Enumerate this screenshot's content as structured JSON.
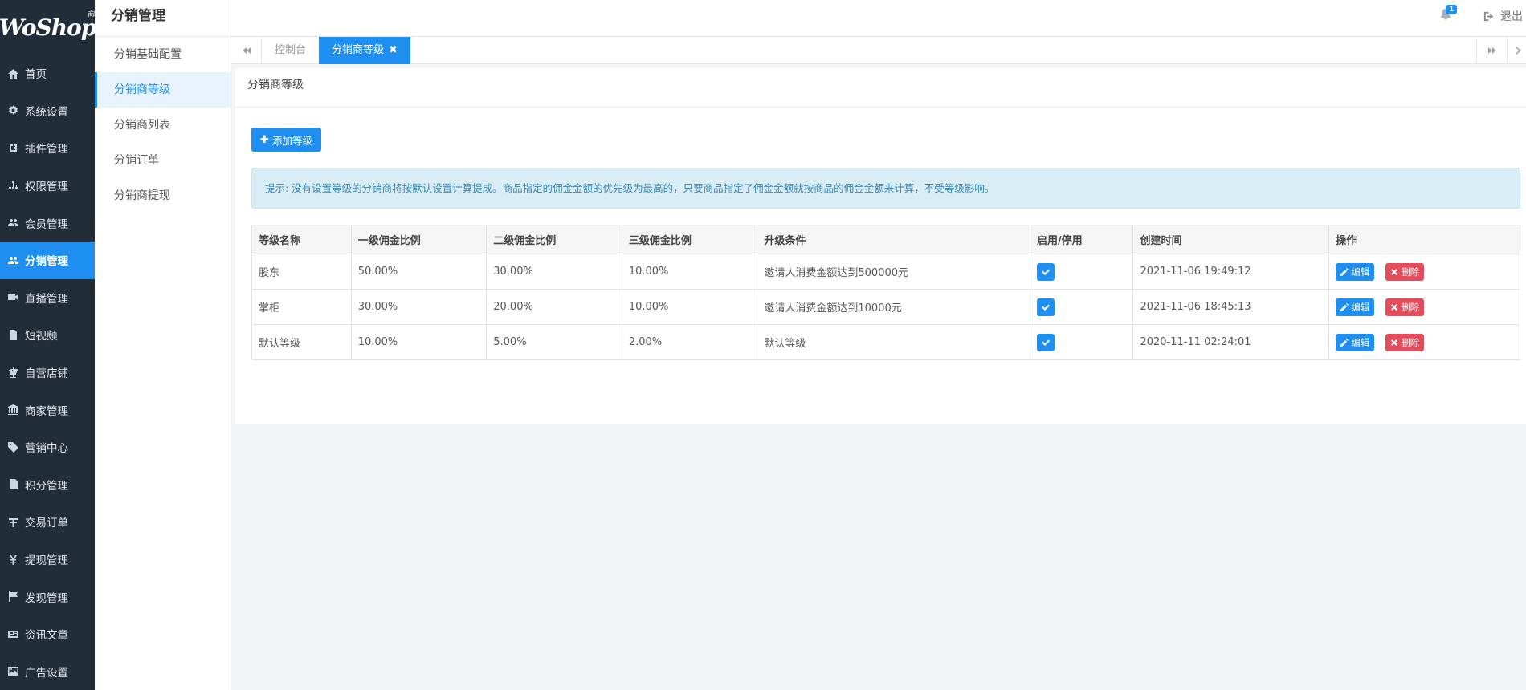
{
  "sidebar": {
    "logo": "WoShop",
    "logo_badge": "商城",
    "items": [
      {
        "label": "首页",
        "icon": "home-icon"
      },
      {
        "label": "系统设置",
        "icon": "gear-icon"
      },
      {
        "label": "插件管理",
        "icon": "plugin-icon"
      },
      {
        "label": "权限管理",
        "icon": "sitemap-icon"
      },
      {
        "label": "会员管理",
        "icon": "users-icon"
      },
      {
        "label": "分销管理",
        "icon": "users-icon",
        "active": true
      },
      {
        "label": "直播管理",
        "icon": "video-icon"
      },
      {
        "label": "短视频",
        "icon": "file-icon"
      },
      {
        "label": "自营店铺",
        "icon": "balance-icon"
      },
      {
        "label": "商家管理",
        "icon": "bank-icon"
      },
      {
        "label": "营销中心",
        "icon": "tag-icon"
      },
      {
        "label": "积分管理",
        "icon": "doc-icon"
      },
      {
        "label": "交易订单",
        "icon": "rmb-icon"
      },
      {
        "label": "提现管理",
        "icon": "yen-icon"
      },
      {
        "label": "发现管理",
        "icon": "flag-icon"
      },
      {
        "label": "资讯文章",
        "icon": "newspaper-icon"
      },
      {
        "label": "广告设置",
        "icon": "image-icon"
      }
    ]
  },
  "subbar": {
    "title": "分销管理",
    "items": [
      {
        "label": "分销基础配置"
      },
      {
        "label": "分销商等级",
        "active": true
      },
      {
        "label": "分销商列表"
      },
      {
        "label": "分销订单"
      },
      {
        "label": "分销商提现"
      }
    ]
  },
  "header": {
    "notification_count": "1",
    "logout_label": "退出"
  },
  "tabs": [
    {
      "label": "控制台"
    },
    {
      "label": "分销商等级",
      "active": true,
      "close": "✖"
    }
  ],
  "panel": {
    "title": "分销商等级",
    "add_button": "添加等级",
    "alert": "提示: 没有设置等级的分销商将按默认设置计算提成。商品指定的佣金金额的优先级为最高的，只要商品指定了佣金金额就按商品的佣金金额来计算，不受等级影响。"
  },
  "table": {
    "columns": [
      "等级名称",
      "一级佣金比例",
      "二级佣金比例",
      "三级佣金比例",
      "升级条件",
      "启用/停用",
      "创建时间",
      "操作"
    ],
    "edit_label": "编辑",
    "delete_label": "删除",
    "rows": [
      {
        "name": "股东",
        "level1": "50.00%",
        "level2": "30.00%",
        "level3": "10.00%",
        "condition": "邀请人消费金额达到500000元",
        "enabled": true,
        "created": "2021-11-06 19:49:12"
      },
      {
        "name": "掌柜",
        "level1": "30.00%",
        "level2": "20.00%",
        "level3": "10.00%",
        "condition": "邀请人消费金额达到10000元",
        "enabled": true,
        "created": "2021-11-06 18:45:13"
      },
      {
        "name": "默认等级",
        "level1": "10.00%",
        "level2": "5.00%",
        "level3": "2.00%",
        "condition": "默认等级",
        "enabled": true,
        "created": "2020-11-11 02:24:01"
      }
    ]
  },
  "colors": {
    "primary": "#1e8ff0",
    "sidebar_bg": "#222d3a",
    "danger": "#e44c5b",
    "alert_bg": "#d9edf7"
  }
}
